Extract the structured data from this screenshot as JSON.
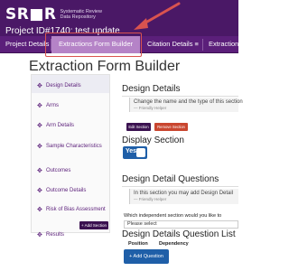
{
  "header": {
    "logo_text": "SR■R",
    "logo_sub_line1": "Systematic Review",
    "logo_sub_line2": "Data Repository",
    "project_line": "Project ID#1740: test update"
  },
  "nav": {
    "items": [
      {
        "label": "Project Details ≡"
      },
      {
        "label": "Extractions Form Builder"
      },
      {
        "label": "Citation Details ≡"
      },
      {
        "label": "Extractions"
      }
    ]
  },
  "page": {
    "title": "Extraction Form Builder"
  },
  "sidebar": {
    "items": [
      {
        "label": "Design Details"
      },
      {
        "label": "Arms"
      },
      {
        "label": "Arm Details"
      },
      {
        "label": "Sample Characteristics"
      },
      {
        "label": "Outcomes"
      },
      {
        "label": "Outcome Details"
      },
      {
        "label": "Risk of Bias Assessment"
      },
      {
        "label": "Results"
      }
    ],
    "add_section_label": "+ Add Section"
  },
  "details": {
    "title": "Design Details",
    "help_text": "Change the name and the type of this section",
    "help_helper": "— Friendly Helper",
    "edit_label": "Edit Section",
    "remove_label": "Remove Section",
    "display_title": "Display Section",
    "toggle_label": "Yes"
  },
  "questions": {
    "title": "Design Detail Questions",
    "help_text": "In this section you may add Design Detail",
    "help_helper": "— Friendly Helper",
    "independent_label": "Which independent section would you like to",
    "select_value": "Please select",
    "list_title": "Design Details Question List",
    "col_position": "Position",
    "col_dependency": "Dependency",
    "add_question_label": "+ Add Question"
  },
  "colors": {
    "header_bg": "#4a1866",
    "nav_bg": "#5b1f7a",
    "nav_active": "#b583c7",
    "highlight": "#d9534f",
    "primary_blue": "#1f5fa8",
    "remove_red": "#c9462f"
  }
}
